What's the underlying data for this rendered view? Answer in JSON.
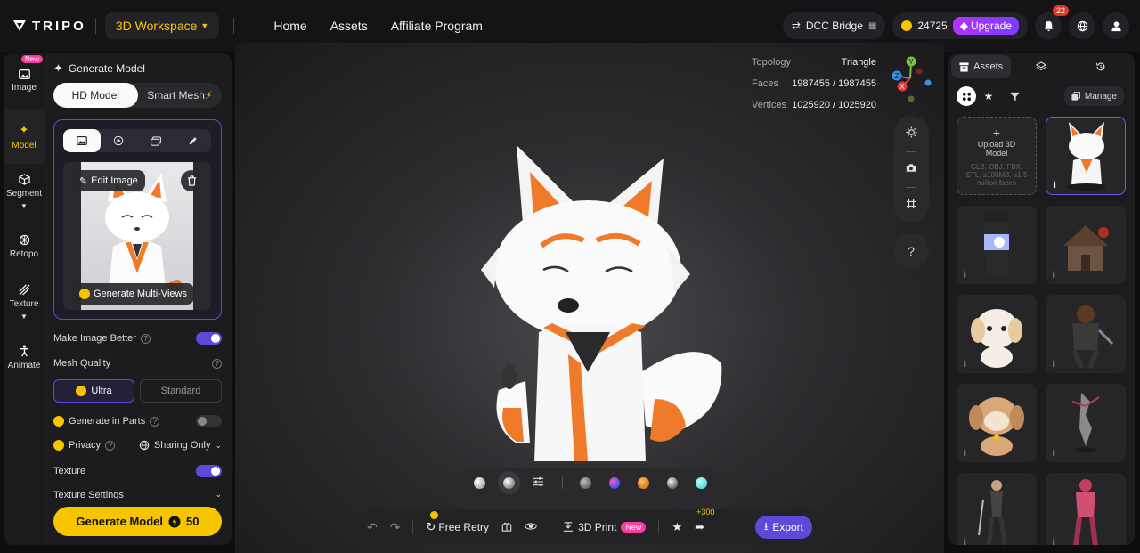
{
  "topbar": {
    "logo_text": "TRIPO",
    "workspace": "3D Workspace",
    "nav": [
      "Home",
      "Assets",
      "Affiliate Program"
    ],
    "dcc_bridge": "DCC Bridge",
    "credits": "24725",
    "upgrade": "Upgrade",
    "notifications": "22"
  },
  "rail": [
    {
      "label": "Image",
      "tag": "New"
    },
    {
      "label": "Model"
    },
    {
      "label": "Segment"
    },
    {
      "label": "Retopo"
    },
    {
      "label": "Texture"
    },
    {
      "label": "Animate"
    }
  ],
  "panel": {
    "title": "Generate Model",
    "mode_hd": "HD Model",
    "mode_smart": "Smart Mesh",
    "edit_image": "Edit Image",
    "multi_views": "Generate Multi-Views",
    "make_better": "Make Image Better",
    "mesh_quality": "Mesh Quality",
    "ultra": "Ultra",
    "standard": "Standard",
    "gen_parts": "Generate in Parts",
    "privacy": "Privacy",
    "sharing": "Sharing Only",
    "texture": "Texture",
    "texture_settings": "Texture Settings",
    "generate": "Generate Model",
    "cost": "50"
  },
  "stats": {
    "topology_label": "Topology",
    "topology_value": "Triangle",
    "faces_label": "Faces",
    "faces_value": "1987455 / 1987455",
    "vertices_label": "Vertices",
    "vertices_value": "1025920 / 1025920"
  },
  "axis": {
    "x": "X",
    "y": "Y",
    "z": "Z"
  },
  "help": "?",
  "bottombar": {
    "free_retry": "Free Retry",
    "print": "3D Print",
    "print_tag": "New",
    "plus": "+300",
    "export": "Export"
  },
  "assets": {
    "tab_assets": "Assets",
    "manage": "Manage",
    "upload_title": "Upload 3D Model",
    "upload_sub": "GLB, OBJ, FBX, STL, ≤100MB, ≤1.5 million faces",
    "info": "i"
  },
  "colors": {
    "accent": "#5b4bd9",
    "brand": "#f7c500",
    "pink": "#ff3aa0"
  }
}
